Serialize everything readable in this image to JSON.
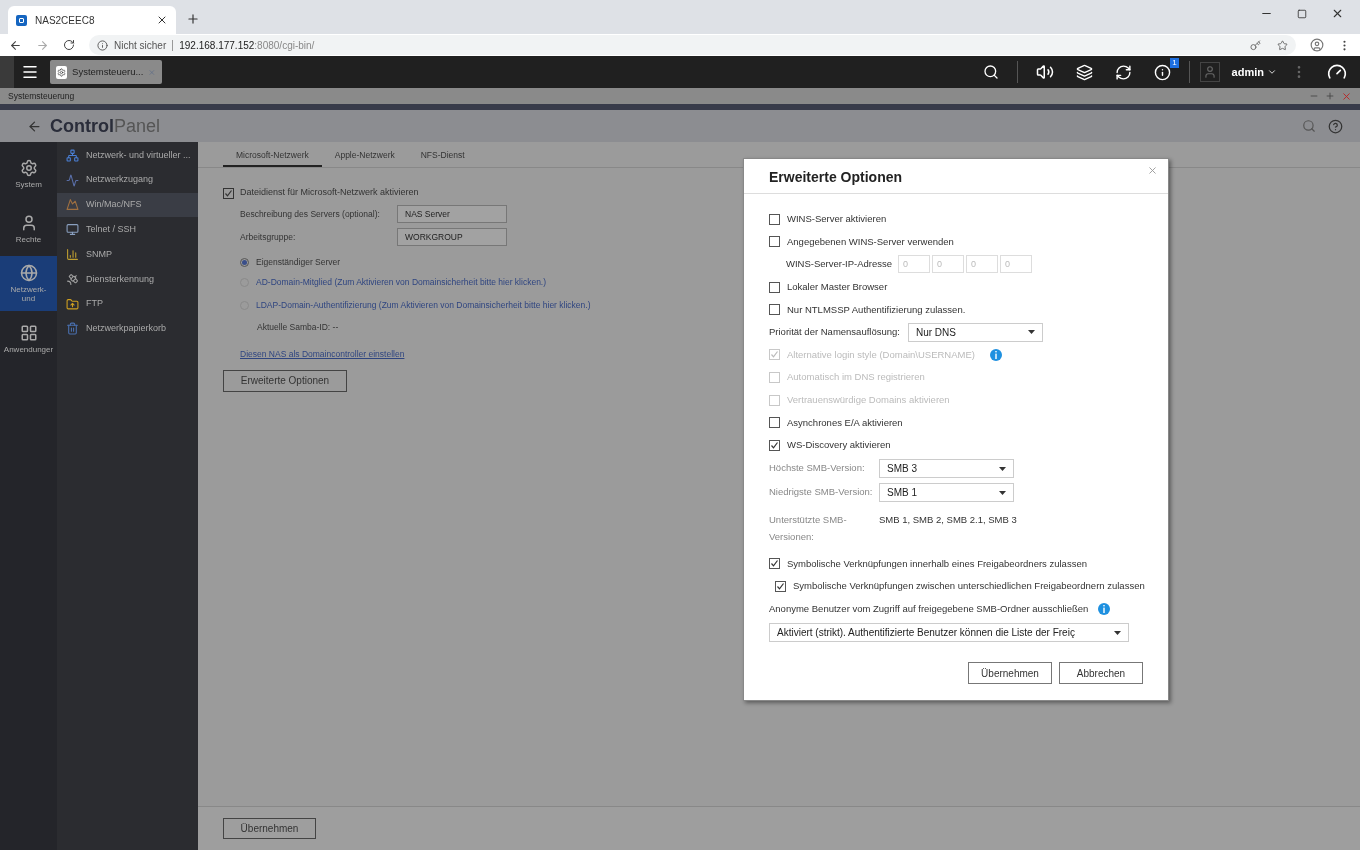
{
  "browser": {
    "tab_title": "NAS2CEEC8",
    "security": "Nicht sicher",
    "url_host": "192.168.177.152",
    "url_rest": ":8080/cgi-bin/"
  },
  "topbar": {
    "app_tab": "Systemsteueru...",
    "user": "admin",
    "badge": "1"
  },
  "window_title": "Systemsteuerung",
  "header": {
    "title_strong": "Control",
    "title_light": "Panel"
  },
  "categories": [
    {
      "label": "System",
      "selected": false
    },
    {
      "label": "Rechte",
      "selected": false
    },
    {
      "label": "Netzwerk-\nund",
      "selected": true
    },
    {
      "label": "Anwendunger",
      "selected": false
    }
  ],
  "nav_items": [
    {
      "label": "Netzwerk- und virtueller ...",
      "selected": false
    },
    {
      "label": "Netzwerkzugang",
      "selected": false
    },
    {
      "label": "Win/Mac/NFS",
      "selected": true
    },
    {
      "label": "Telnet / SSH",
      "selected": false
    },
    {
      "label": "SNMP",
      "selected": false
    },
    {
      "label": "Diensterkennung",
      "selected": false
    },
    {
      "label": "FTP",
      "selected": false
    },
    {
      "label": "Netzwerkpapierkorb",
      "selected": false
    }
  ],
  "tabs": [
    {
      "label": "Microsoft-Netzwerk",
      "selected": true
    },
    {
      "label": "Apple-Netzwerk",
      "selected": false
    },
    {
      "label": "NFS-Dienst",
      "selected": false
    }
  ],
  "main": {
    "enable": {
      "label": "Dateidienst für Microsoft-Netzwerk aktivieren",
      "checked": true
    },
    "fields": [
      {
        "label": "Beschreibung des Servers (optional):",
        "value": "NAS Server"
      },
      {
        "label": "Arbeitsgruppe:",
        "value": "WORKGROUP"
      }
    ],
    "modes": [
      {
        "label": "Eigenständiger Server",
        "selected": true,
        "link": false
      },
      {
        "label": "AD-Domain-Mitglied (Zum Aktivieren von Domainsicherheit bitte hier klicken.)",
        "selected": false,
        "link": true
      },
      {
        "label": "LDAP-Domain-Authentifizierung (Zum Aktivieren von Domainsicherheit bitte hier klicken.)",
        "selected": false,
        "link": true
      }
    ],
    "samba_id": "Aktuelle Samba-ID: --",
    "dc_link": "Diesen NAS als Domaincontroller einstellen",
    "advanced_button": "Erweiterte Optionen",
    "apply_button": "Übernehmen"
  },
  "dialog": {
    "title": "Erweiterte Optionen",
    "options": [
      {
        "kind": "checkbox",
        "label": "WINS-Server aktivieren",
        "checked": false,
        "disabled": false
      },
      {
        "kind": "checkbox",
        "label": "Angegebenen WINS-Server verwenden",
        "checked": false,
        "disabled": false
      },
      {
        "kind": "ip",
        "label": "WINS-Server-IP-Adresse",
        "placeholders": [
          "0",
          "0",
          "0",
          "0"
        ]
      },
      {
        "kind": "checkbox",
        "label": "Lokaler Master Browser",
        "checked": false,
        "disabled": false
      },
      {
        "kind": "checkbox",
        "label": "Nur NTLMSSP Authentifizierung zulassen.",
        "checked": false,
        "disabled": false
      },
      {
        "kind": "inline-select",
        "label": "Priorität der Namensauflösung:",
        "value": "Nur DNS"
      },
      {
        "kind": "checkbox",
        "label": "Alternative login style (Domain\\USERNAME)",
        "checked": true,
        "disabled": true,
        "info": true
      },
      {
        "kind": "checkbox",
        "label": "Automatisch im DNS registrieren",
        "checked": false,
        "disabled": true
      },
      {
        "kind": "checkbox",
        "label": "Vertrauenswürdige Domains aktivieren",
        "checked": false,
        "disabled": true
      },
      {
        "kind": "checkbox",
        "label": "Asynchrones E/A aktivieren",
        "checked": false,
        "disabled": false
      },
      {
        "kind": "checkbox",
        "label": "WS-Discovery aktivieren",
        "checked": true,
        "disabled": false
      },
      {
        "kind": "select",
        "label": "Höchste SMB-Version:",
        "value": "SMB 3"
      },
      {
        "kind": "select",
        "label": "Niedrigste SMB-Version:",
        "value": "SMB 1"
      },
      {
        "kind": "text",
        "label": "Unterstützte SMB-Versionen:",
        "value": "SMB 1, SMB 2, SMB 2.1, SMB 3"
      },
      {
        "kind": "checkbox",
        "label": "Symbolische Verknüpfungen innerhalb eines Freigabeordners zulassen",
        "checked": true,
        "disabled": false,
        "children": [
          {
            "kind": "checkbox",
            "label": "Symbolische Verknüpfungen zwischen unterschiedlichen Freigabeordnern zulassen",
            "checked": true,
            "disabled": false
          }
        ]
      },
      {
        "kind": "note",
        "label": "Anonyme Benutzer vom Zugriff auf freigegebene SMB-Ordner ausschließen",
        "info": true
      },
      {
        "kind": "wide-select",
        "value": "Aktiviert (strikt). Authentifizierte Benutzer können die Liste der Freiç"
      }
    ],
    "buttons": [
      "Übernehmen",
      "Abbrechen"
    ]
  }
}
